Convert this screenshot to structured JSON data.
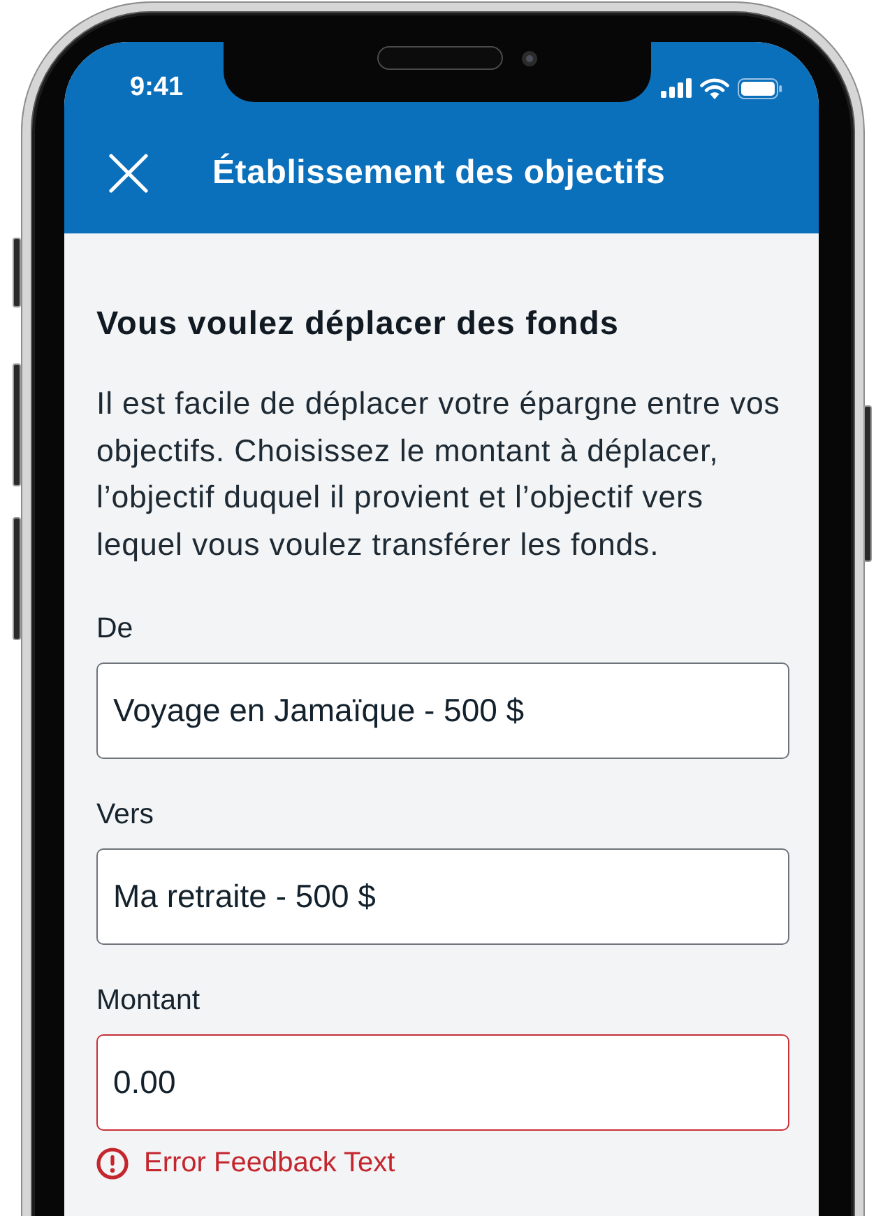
{
  "status_bar": {
    "time": "9:41"
  },
  "header": {
    "title": "Établissement des objectifs"
  },
  "content": {
    "heading": "Vous voulez déplacer des fonds",
    "description": "Il est facile de déplacer votre épargne entre vos objectifs. Choisissez le montant à déplacer, l’objectif duquel il provient et l’objectif vers lequel vous voulez transférer les fonds.",
    "fields": [
      {
        "label": "De",
        "value": "Voyage en Jamaïque - 500 $",
        "invalid": false
      },
      {
        "label": "Vers",
        "value": "Ma retraite - 500 $",
        "invalid": false
      },
      {
        "label": "Montant",
        "value": "0.00",
        "invalid": true,
        "error": "Error Feedback Text"
      }
    ]
  }
}
